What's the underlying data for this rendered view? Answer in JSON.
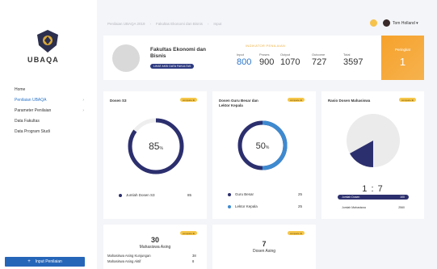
{
  "sidebar": {
    "brand": "UBAQA",
    "items": [
      {
        "label": "Home",
        "active": false,
        "chevron": ""
      },
      {
        "label": "Penilaian UBAQA",
        "active": true,
        "chevron": "›"
      },
      {
        "label": "Parameter Penilaian",
        "active": false,
        "chevron": "›"
      },
      {
        "label": "Data Fakultas",
        "active": false,
        "chevron": ""
      },
      {
        "label": "Data Program Studi",
        "active": false,
        "chevron": ""
      }
    ],
    "input_button": "Input Penilaian",
    "input_plus": "+"
  },
  "header": {
    "crumbs": [
      "Penilaian UBAQA 2019",
      "Fakultas Ekonomi dan Bisnis",
      "Input"
    ],
    "sep": "›",
    "username": "Tom Holland ▾"
  },
  "topcard": {
    "faculty_name": "Fakultas Ekonomi dan Bisnis",
    "faculty_link": "LIHAT AKSI DATA FAKULTAS",
    "indicator_title": "INDIKATOR PENILAIAN",
    "metrics": [
      {
        "label": "Input",
        "value": "800"
      },
      {
        "label": "Proses",
        "value": "900"
      },
      {
        "label": "Output",
        "value": "1070"
      },
      {
        "label": "Outcome",
        "value": "727"
      },
      {
        "label": "Total",
        "value": "3597"
      }
    ],
    "peringkat_label": "Peringkat",
    "peringkat_value": "1"
  },
  "badge_label": "compare ⊕",
  "cards": {
    "dosen_s3": {
      "title": "Dosen S3",
      "percent": "85",
      "percent_unit": "%",
      "fraction": 0.85,
      "legend_label": "Jumlah Dosen S3",
      "legend_value": "85",
      "color": "#2c2f6e"
    },
    "guru_besar": {
      "title_line1": "Dosen Guru Besar dan",
      "title_line2": "Lektor Kepala",
      "percent": "50",
      "percent_unit": "%",
      "fraction": 0.5,
      "legend": [
        {
          "label": "Guru Besar",
          "value": "25",
          "color": "#2c2f6e"
        },
        {
          "label": "Lektor Kepala",
          "value": "25",
          "color": "#3e8ad0"
        }
      ]
    },
    "rasio": {
      "title": "Rasio Dosen Mahasiswa",
      "ratio": "1 : 7",
      "rows": [
        {
          "label": "Jumlah Dosen",
          "value": "100"
        },
        {
          "label": "Jumlah Mahasiswa",
          "value": "2560"
        }
      ]
    },
    "mahasiswa_asing": {
      "number": "30",
      "label": "Mahasiswa Asing",
      "rows": [
        {
          "label": "Mahasiswa Asing Kunjungan",
          "value": "38"
        },
        {
          "label": "Mahasiswa Asing Aktif",
          "value": "8"
        }
      ]
    },
    "dosen_asing": {
      "number": "7",
      "label": "Dosen Asing"
    }
  },
  "colors": {
    "accent_blue": "#2a74c9",
    "navy": "#2c2f6e",
    "orange": "#f6a22b",
    "badge": "#f6c74a"
  }
}
